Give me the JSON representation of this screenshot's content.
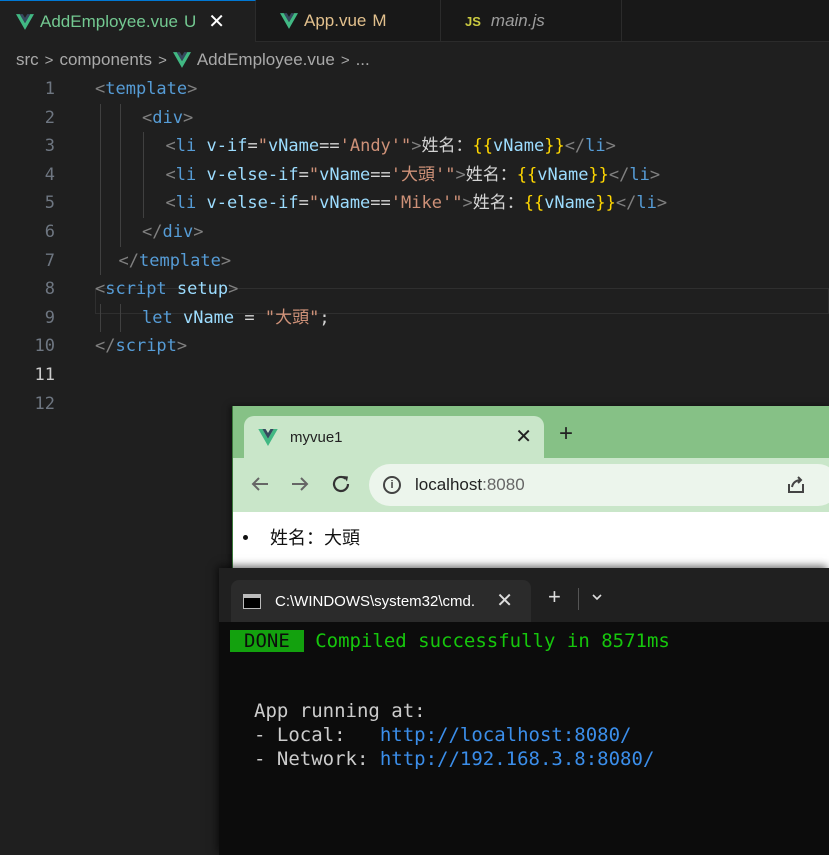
{
  "editor": {
    "tabs": [
      {
        "name": "AddEmployee.vue",
        "status": "U",
        "close": "✕",
        "icon": "vue-icon"
      },
      {
        "name": "App.vue",
        "status": "M",
        "icon": "vue-icon"
      },
      {
        "name": "main.js",
        "icon_label": "JS"
      }
    ],
    "breadcrumb": [
      "src",
      "components",
      "AddEmployee.vue",
      "..."
    ],
    "breadcrumb_sep": ">",
    "lines": [
      {
        "n": "1",
        "tokens": [
          [
            "br",
            "<"
          ],
          [
            "tag",
            "template"
          ],
          [
            "br",
            ">"
          ]
        ],
        "indent": 0,
        "guides": []
      },
      {
        "n": "2",
        "tokens": [
          [
            "br",
            "<"
          ],
          [
            "tag",
            "div"
          ],
          [
            "br",
            ">"
          ]
        ],
        "indent": 0,
        "guides": [
          0
        ]
      },
      {
        "n": "3",
        "tokens": [
          [
            "br",
            "<"
          ],
          [
            "tag",
            "li"
          ],
          [
            "txt",
            " "
          ],
          [
            "attr",
            "v-if"
          ],
          [
            "txt",
            "="
          ],
          [
            "str",
            "\""
          ],
          [
            "attr",
            "vName"
          ],
          [
            "txt",
            "=="
          ],
          [
            "str",
            "'Andy'"
          ],
          [
            "str",
            "\""
          ],
          [
            "br",
            ">"
          ],
          [
            "txt",
            "姓名："
          ],
          [
            "mus",
            "{{"
          ],
          [
            "attr",
            "vName"
          ],
          [
            "mus",
            "}}"
          ],
          [
            "br",
            "</"
          ],
          [
            "tag",
            "li"
          ],
          [
            "br",
            ">"
          ]
        ],
        "indent": 0,
        "guides": [
          0,
          1
        ]
      },
      {
        "n": "4",
        "tokens": [
          [
            "br",
            "<"
          ],
          [
            "tag",
            "li"
          ],
          [
            "txt",
            " "
          ],
          [
            "attr",
            "v-else-if"
          ],
          [
            "txt",
            "="
          ],
          [
            "str",
            "\""
          ],
          [
            "attr",
            "vName"
          ],
          [
            "txt",
            "=="
          ],
          [
            "str",
            "'大頭'"
          ],
          [
            "str",
            "\""
          ],
          [
            "br",
            ">"
          ],
          [
            "txt",
            "姓名："
          ],
          [
            "mus",
            "{{"
          ],
          [
            "attr",
            "vName"
          ],
          [
            "mus",
            "}}"
          ],
          [
            "br",
            "</"
          ],
          [
            "tag",
            "li"
          ],
          [
            "br",
            ">"
          ]
        ],
        "indent": 0,
        "guides": [
          0,
          1
        ]
      },
      {
        "n": "5",
        "tokens": [
          [
            "br",
            "<"
          ],
          [
            "tag",
            "li"
          ],
          [
            "txt",
            " "
          ],
          [
            "attr",
            "v-else-if"
          ],
          [
            "txt",
            "="
          ],
          [
            "str",
            "\""
          ],
          [
            "attr",
            "vName"
          ],
          [
            "txt",
            "=="
          ],
          [
            "str",
            "'Mike'"
          ],
          [
            "str",
            "\""
          ],
          [
            "br",
            ">"
          ],
          [
            "txt",
            "姓名："
          ],
          [
            "mus",
            "{{"
          ],
          [
            "attr",
            "vName"
          ],
          [
            "mus",
            "}}"
          ],
          [
            "br",
            "</"
          ],
          [
            "tag",
            "li"
          ],
          [
            "br",
            ">"
          ]
        ],
        "indent": 0,
        "guides": [
          0,
          1
        ]
      },
      {
        "n": "6",
        "tokens": [
          [
            "br",
            "</"
          ],
          [
            "tag",
            "div"
          ],
          [
            "br",
            ">"
          ]
        ],
        "indent": 0,
        "guides": [
          0
        ]
      },
      {
        "n": "7",
        "tokens": [
          [
            "br",
            "</"
          ],
          [
            "tag",
            "template"
          ],
          [
            "br",
            ">"
          ]
        ],
        "indent": 0,
        "guides": []
      },
      {
        "n": "8",
        "tokens": [
          [
            "br",
            "<"
          ],
          [
            "tag",
            "script"
          ],
          [
            "txt",
            " "
          ],
          [
            "attr",
            "setup"
          ],
          [
            "br",
            ">"
          ]
        ],
        "indent": 0,
        "guides": []
      },
      {
        "n": "9",
        "tokens": [
          [
            "kw",
            "let"
          ],
          [
            "txt",
            " "
          ],
          [
            "ident",
            "vName"
          ],
          [
            "txt",
            " = "
          ],
          [
            "str",
            "\"大頭\""
          ],
          [
            "txt",
            ";"
          ]
        ],
        "indent": 0,
        "guides": [
          0
        ]
      },
      {
        "n": "10",
        "tokens": [
          [
            "br",
            "</"
          ],
          [
            "tag",
            "script"
          ],
          [
            "br",
            ">"
          ]
        ],
        "indent": 0,
        "guides": []
      },
      {
        "n": "11",
        "tokens": [],
        "indent": 0,
        "guides": [],
        "current": true
      },
      {
        "n": "12",
        "tokens": [],
        "indent": 0,
        "guides": []
      }
    ]
  },
  "browser": {
    "tab_title": "myvue1",
    "tab_close": "✕",
    "new_tab": "+",
    "url_host": "localhost",
    "url_port": ":8080",
    "list_item": "姓名：大頭"
  },
  "terminal": {
    "tab_title": "C:\\WINDOWS\\system32\\cmd.",
    "tab_close": "✕",
    "new_tab": "+",
    "done_label": "DONE",
    "compiled_msg": "Compiled successfully in 8571ms",
    "running_label": "App running at:",
    "local_label": "- Local:   ",
    "local_url": "http://localhost:8080/",
    "network_label": "- Network: ",
    "network_url": "http://192.168.3.8:8080/"
  },
  "colors": {
    "vue_green": "#41b883",
    "vue_dark": "#35495e",
    "browser_frame": "#86c186",
    "terminal_done": "#13a10e"
  }
}
